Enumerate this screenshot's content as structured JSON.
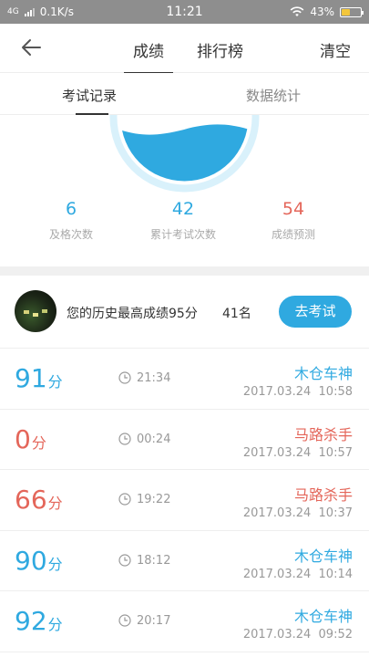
{
  "status_bar": {
    "network": "4G",
    "speed": "0.1K/s",
    "time": "11:21",
    "battery": "43%",
    "battery_level": 0.43
  },
  "header": {
    "tabs": [
      "成绩",
      "排行榜"
    ],
    "active_tab": "成绩",
    "clear_label": "清空"
  },
  "subtabs": [
    "考试记录",
    "数据统计"
  ],
  "stats": [
    {
      "value": "6",
      "label": "及格次数",
      "color": "#2fa9e0"
    },
    {
      "value": "42",
      "label": "累计考试次数",
      "color": "#2fa9e0"
    },
    {
      "value": "54",
      "label": "成绩预测",
      "color": "#e4665a"
    }
  ],
  "best": {
    "text": "您的历史最高成绩95分",
    "rank": "41名",
    "button": "去考试"
  },
  "records": [
    {
      "score": "91",
      "unit": "分",
      "duration": "21:34",
      "name": "木仓车神",
      "date": "2017.03.24",
      "time": "10:58",
      "tone": "blue"
    },
    {
      "score": "0",
      "unit": "分",
      "duration": "00:24",
      "name": "马路杀手",
      "date": "2017.03.24",
      "time": "10:57",
      "tone": "red"
    },
    {
      "score": "66",
      "unit": "分",
      "duration": "19:22",
      "name": "马路杀手",
      "date": "2017.03.24",
      "time": "10:37",
      "tone": "red"
    },
    {
      "score": "90",
      "unit": "分",
      "duration": "18:12",
      "name": "木仓车神",
      "date": "2017.03.24",
      "time": "10:14",
      "tone": "blue"
    },
    {
      "score": "92",
      "unit": "分",
      "duration": "20:17",
      "name": "木仓车神",
      "date": "2017.03.24",
      "time": "09:52",
      "tone": "blue"
    }
  ],
  "colors": {
    "accent": "#2fa9e0",
    "danger": "#e4665a",
    "gauge_ring": "#d9f1fb",
    "gauge_water": "#2fa9e0"
  },
  "icons": {
    "back": "back-arrow-icon",
    "clock": "clock-icon",
    "wifi": "wifi-icon",
    "signal": "signal-bars-icon",
    "battery": "battery-icon"
  }
}
